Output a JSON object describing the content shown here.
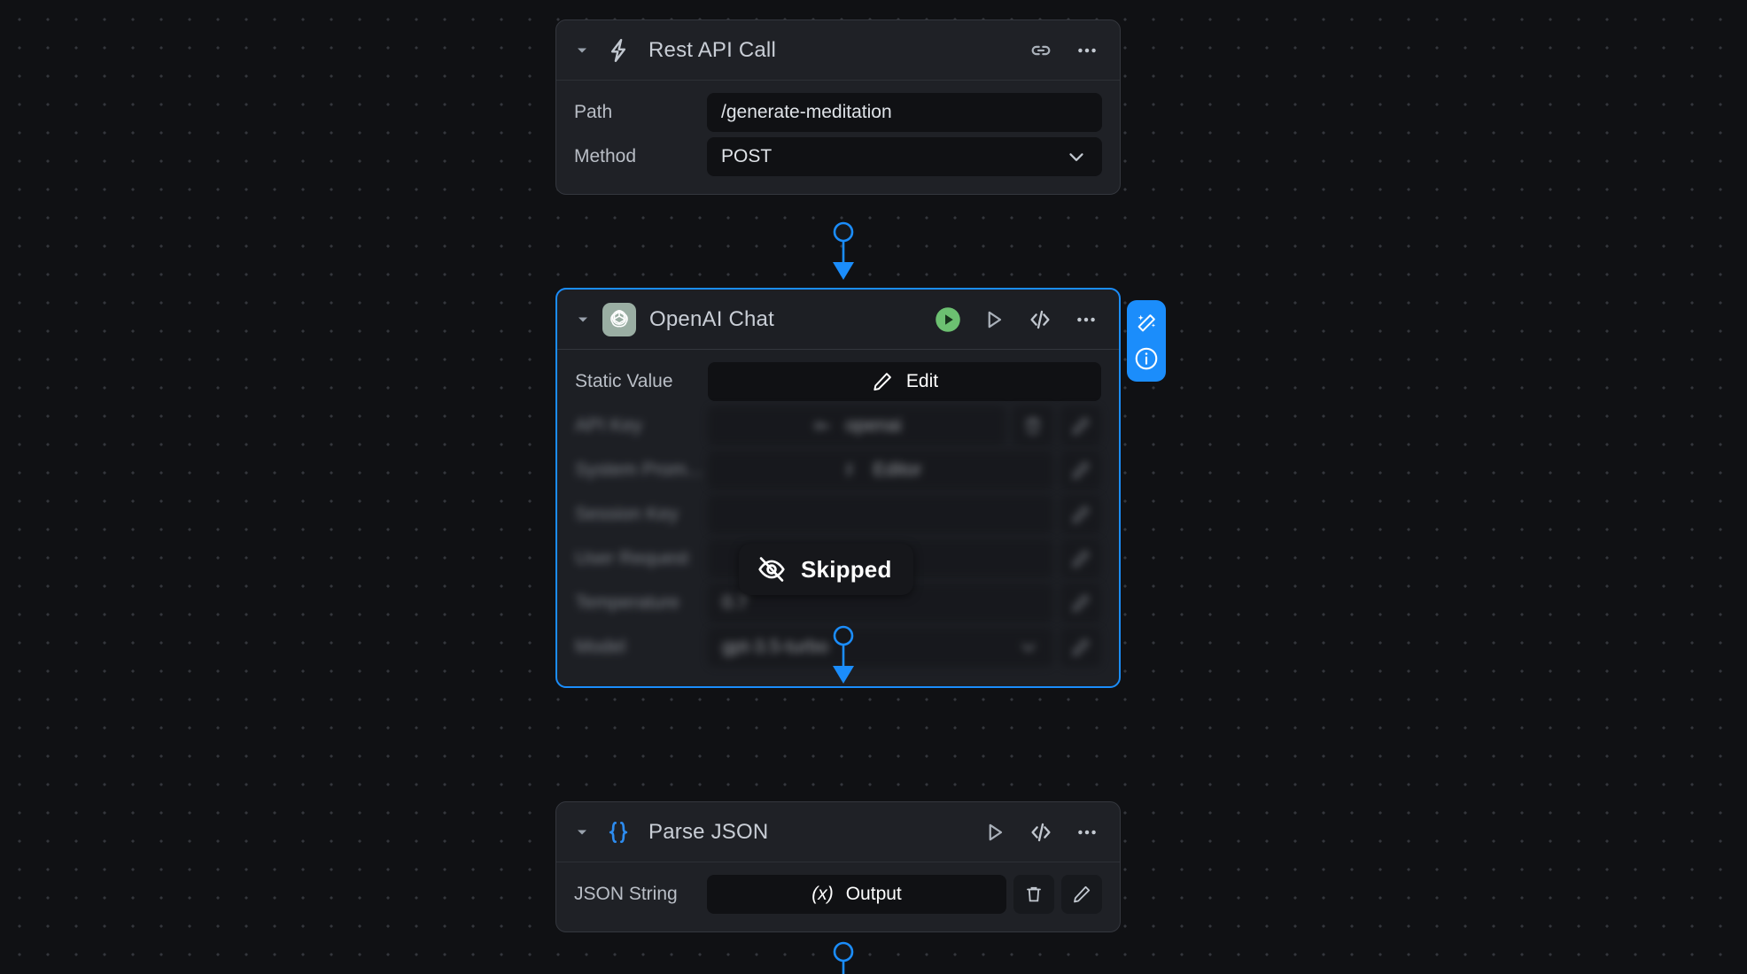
{
  "canvas": {
    "background_color": "#101114",
    "grid_dot_color": "#34363c",
    "accent_color": "#1b8dfb",
    "run_color": "#6cc071"
  },
  "nodes": [
    {
      "id": "rest-api-call",
      "title": "Rest API Call",
      "icon": "lightning-bolt-icon",
      "selected": false,
      "header_actions": [
        "link-icon",
        "more-options-icon"
      ],
      "rows": [
        {
          "label": "Path",
          "value": "/generate-meditation",
          "type": "text"
        },
        {
          "label": "Method",
          "value": "POST",
          "type": "select"
        }
      ]
    },
    {
      "id": "openai-chat",
      "title": "OpenAI Chat",
      "icon": "openai-logo-icon",
      "selected": true,
      "status_badge": {
        "label": "Skipped",
        "icon": "eye-off-icon"
      },
      "header_actions": [
        "run-node-icon",
        "play-icon",
        "code-icon",
        "more-options-icon"
      ],
      "rows": [
        {
          "label": "Static Value",
          "value": "Edit",
          "type": "button",
          "icon": "pencil-icon",
          "blurred": false
        },
        {
          "label": "API Key",
          "value": "openai",
          "type": "variable",
          "icon": "key-icon",
          "actions": [
            "trash-icon",
            "pencil-icon"
          ],
          "blurred": true
        },
        {
          "label": "System Prom...",
          "value": "Editor",
          "type": "button",
          "icon": "fx-icon",
          "actions": [
            "pencil-icon"
          ],
          "blurred": true
        },
        {
          "label": "Session Key",
          "value": "",
          "type": "text",
          "actions": [
            "pencil-icon"
          ],
          "blurred": true
        },
        {
          "label": "User Request",
          "value": "",
          "type": "variable",
          "actions": [
            "pencil-icon"
          ],
          "blurred": true
        },
        {
          "label": "Temperature",
          "value": "0.7",
          "type": "text",
          "actions": [
            "pencil-icon"
          ],
          "blurred": true
        },
        {
          "label": "Model",
          "value": "gpt-3.5-turbo",
          "type": "select",
          "actions": [
            "pencil-icon"
          ],
          "blurred": true
        }
      ]
    },
    {
      "id": "parse-json",
      "title": "Parse JSON",
      "icon": "curly-braces-icon",
      "selected": false,
      "header_actions": [
        "play-icon",
        "code-icon",
        "more-options-icon"
      ],
      "rows": [
        {
          "label": "JSON String",
          "value": "Output",
          "type": "variable",
          "icon": "fx-variable-icon",
          "actions": [
            "trash-icon",
            "pencil-icon"
          ]
        }
      ]
    }
  ],
  "floating_toolbar": {
    "buttons": [
      {
        "name": "magic-wand-icon",
        "label": ""
      },
      {
        "name": "info-icon",
        "label": ""
      }
    ]
  }
}
